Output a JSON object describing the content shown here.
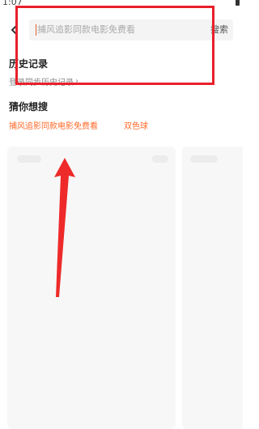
{
  "status_bar": {
    "time": "1:07"
  },
  "search": {
    "placeholder": "捕风追影同款电影免费看",
    "button_label": "搜索"
  },
  "history": {
    "title": "历史记录",
    "login_sync": "登录同步历史记录"
  },
  "guess": {
    "title": "猜你想搜",
    "items": [
      "捕风追影同款电影免费看",
      "双色球"
    ]
  },
  "colors": {
    "accent": "#ff6a2a",
    "annotation_red": "#e8202a"
  },
  "icons": {
    "back": "chevron-left-icon",
    "login_chevron": "chevron-right-icon"
  }
}
